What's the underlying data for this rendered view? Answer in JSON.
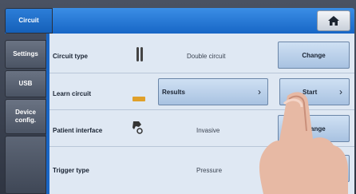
{
  "header": {
    "title": "Circuit"
  },
  "sidebar": {
    "items": [
      {
        "label": "Settings"
      },
      {
        "label": "USB"
      },
      {
        "label": "Device config."
      }
    ]
  },
  "rows": [
    {
      "label": "Circuit type",
      "value": "Double circuit",
      "button": "Change",
      "icon": "circuit-tube-icon"
    },
    {
      "label": "Learn circuit",
      "button_left": "Results",
      "button_right": "Start",
      "icon": "circuit-indicator-icon"
    },
    {
      "label": "Patient interface",
      "value": "Invasive",
      "button": "Change",
      "icon": "patient-interface-icon"
    },
    {
      "label": "Trigger type",
      "value": "Pressure",
      "icon": "trigger-icon"
    }
  ],
  "colors": {
    "accent": "#1a66c5",
    "panel": "#dfe8f3",
    "button": "#cfe0f3"
  }
}
